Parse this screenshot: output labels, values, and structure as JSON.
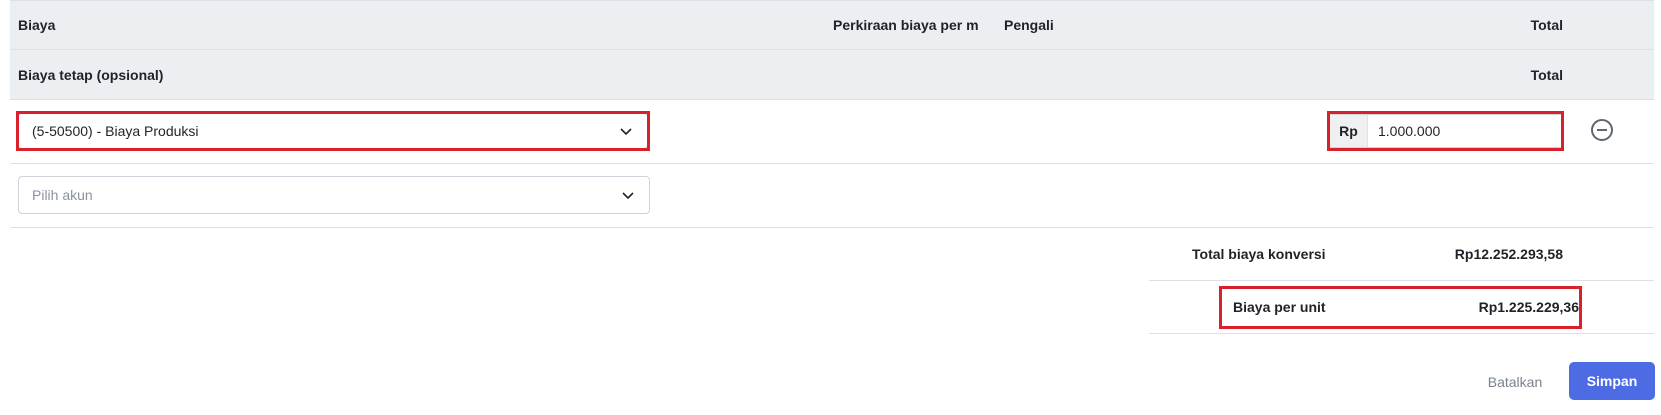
{
  "table": {
    "headers": {
      "biaya": "Biaya",
      "perkiraan": "Perkiraan biaya per m",
      "pengali": "Pengali",
      "total": "Total"
    },
    "section": {
      "title": "Biaya tetap (opsional)",
      "total_label": "Total"
    },
    "rows": [
      {
        "account": "(5-50500) - Biaya Produksi",
        "currency_prefix": "Rp",
        "amount": "1.000.000"
      }
    ],
    "new_account_placeholder": "Pilih akun"
  },
  "summary": {
    "conversion_label": "Total biaya konversi",
    "conversion_value": "Rp12.252.293,58",
    "unit_label": "Biaya per unit",
    "unit_value": "Rp1.225.229,36"
  },
  "actions": {
    "cancel_label": "Batalkan",
    "save_label": "Simpan"
  },
  "colors": {
    "header_bg": "#eceff2",
    "highlight": "#d9212c",
    "primary": "#4d6be3"
  },
  "icons": [
    "chevron-down-icon",
    "remove-circle-icon"
  ]
}
